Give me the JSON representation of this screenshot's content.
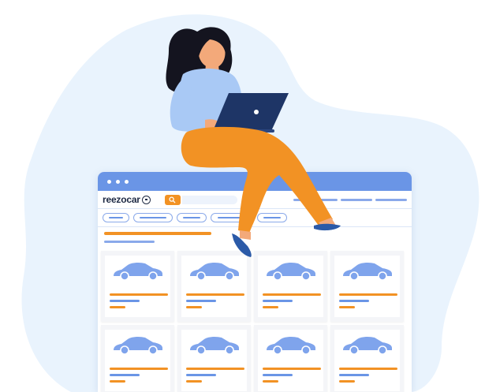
{
  "brand": {
    "name": "reezocar",
    "logo_icon": "magnifier-icon"
  },
  "colors": {
    "accent": "#f29224",
    "primary": "#6a95e6",
    "light_blue_bg": "#e9f3fd",
    "car_blue": "#7fa4ec"
  },
  "search": {
    "icon": "search-icon"
  },
  "window": {
    "dots": 3
  },
  "cards": [
    {
      "id": 1,
      "icon": "car-icon"
    },
    {
      "id": 2,
      "icon": "car-icon"
    },
    {
      "id": 3,
      "icon": "car-icon"
    },
    {
      "id": 4,
      "icon": "car-icon"
    },
    {
      "id": 5,
      "icon": "car-icon"
    },
    {
      "id": 6,
      "icon": "car-icon"
    },
    {
      "id": 7,
      "icon": "car-icon"
    },
    {
      "id": 8,
      "icon": "car-icon"
    }
  ]
}
